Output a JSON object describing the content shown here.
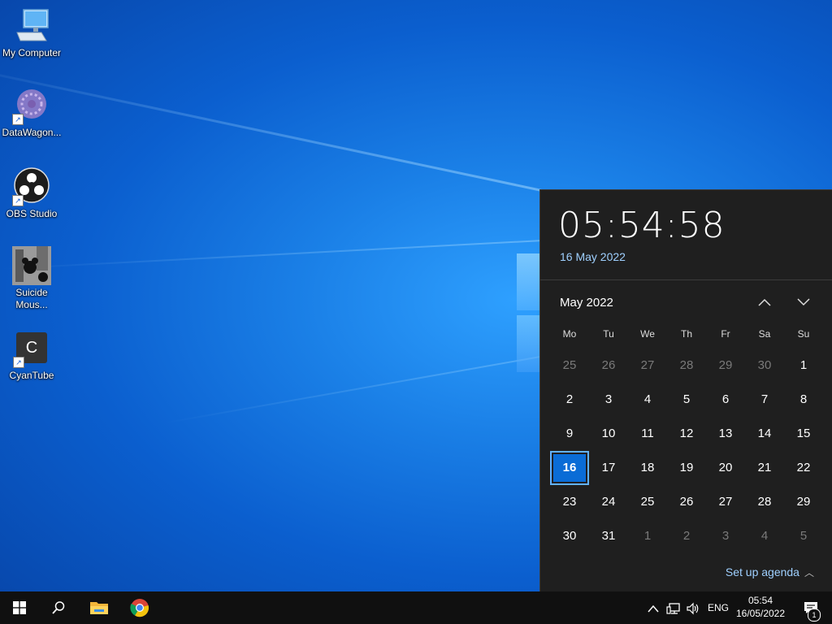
{
  "desktop": {
    "icons": [
      {
        "label": "My Computer",
        "icon": "computer-icon"
      },
      {
        "label": "DataWagon...",
        "icon": "datawagon-icon"
      },
      {
        "label": "OBS Studio",
        "icon": "obs-icon"
      },
      {
        "label": "Suicide Mous...",
        "icon": "suicide-mouse-icon"
      },
      {
        "label": "CyanTube",
        "icon": "cyantube-icon",
        "letter": "C"
      }
    ]
  },
  "flyout": {
    "time": "05:54:58",
    "long_date": "16 May 2022",
    "month_title": "May 2022",
    "weekdays": [
      "Mo",
      "Tu",
      "We",
      "Th",
      "Fr",
      "Sa",
      "Su"
    ],
    "days": [
      "25",
      "26",
      "27",
      "28",
      "29",
      "30",
      "1",
      "2",
      "3",
      "4",
      "5",
      "6",
      "7",
      "8",
      "9",
      "10",
      "11",
      "12",
      "13",
      "14",
      "15",
      "16",
      "17",
      "18",
      "19",
      "20",
      "21",
      "22",
      "23",
      "24",
      "25",
      "26",
      "27",
      "28",
      "29",
      "30",
      "31",
      "1",
      "2",
      "3",
      "4",
      "5"
    ],
    "today": "16",
    "agenda_label": "Set up agenda"
  },
  "taskbar": {
    "language": "ENG",
    "clock_time": "05:54",
    "clock_date": "16/05/2022",
    "notification_count": "1"
  },
  "colors": {
    "accent": "#0a6cd6",
    "link": "#9fd0ff",
    "flyout_bg": "#1f1f1f",
    "taskbar_bg": "#101010"
  }
}
